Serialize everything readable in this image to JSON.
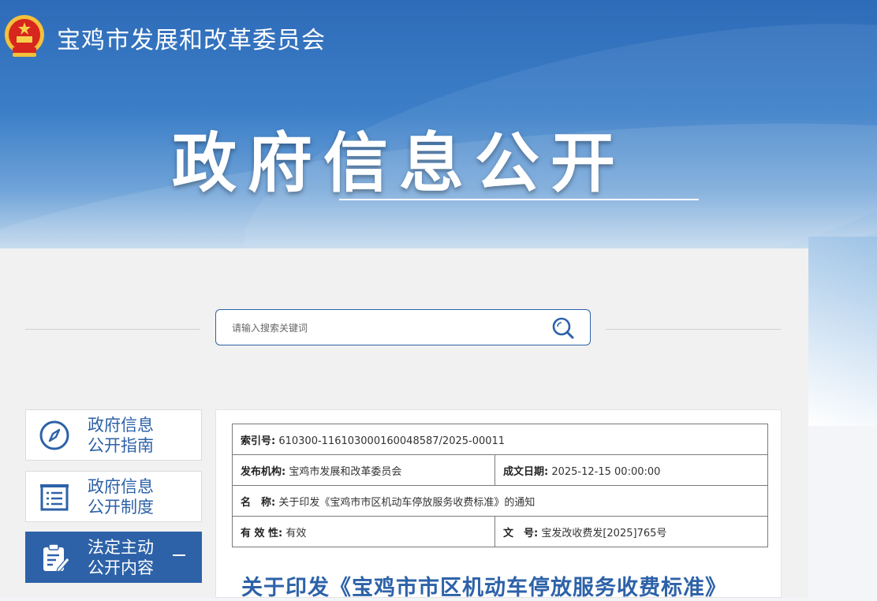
{
  "header": {
    "org_name": "宝鸡市发展和改革委员会",
    "page_title": "政府信息公开"
  },
  "search": {
    "placeholder": "请输入搜索关键词"
  },
  "sidebar": {
    "items": [
      {
        "line1": "政府信息",
        "line2": "公开指南",
        "icon": "compass-icon",
        "active": false
      },
      {
        "line1": "政府信息",
        "line2": "公开制度",
        "icon": "list-document-icon",
        "active": false
      },
      {
        "line1": "法定主动",
        "line2": "公开内容",
        "icon": "clipboard-edit-icon",
        "active": true,
        "expand_symbol": "—"
      }
    ]
  },
  "document": {
    "index_label": "索引号:",
    "index_value": "610300-116103000160048587/2025-00011",
    "publisher_label": "发布机构:",
    "publisher_value": "宝鸡市发展和改革委员会",
    "date_label": "成文日期:",
    "date_value": "2025-12-15 00:00:00",
    "name_label": "名　称:",
    "name_value": "关于印发《宝鸡市市区机动车停放服务收费标准》的通知",
    "validity_label": "有 效 性:",
    "validity_value": "有效",
    "number_label": "文　号:",
    "number_value": "宝发改收费发[2025]765号",
    "title": "关于印发《宝鸡市市区机动车停放服务收费标准》"
  },
  "colors": {
    "accent": "#2d62a8",
    "banner_top": "#2e6bb8"
  }
}
